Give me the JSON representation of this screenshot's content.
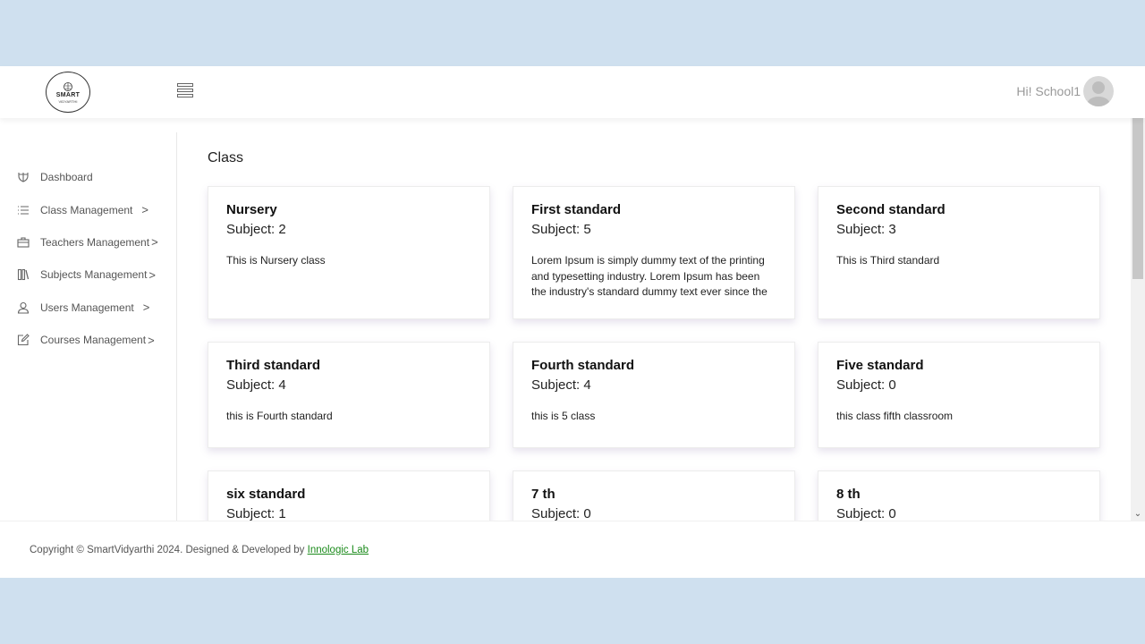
{
  "header": {
    "logo_line1": "SMART",
    "logo_line2": "VIDYARTHI",
    "greeting": "Hi! School1"
  },
  "sidebar": {
    "items": [
      {
        "label": "Dashboard",
        "icon": "dashboard-icon",
        "chevron": ""
      },
      {
        "label": "Class Management",
        "icon": "list-icon",
        "chevron": ">"
      },
      {
        "label": "Teachers Management",
        "icon": "briefcase-icon",
        "chevron": ">"
      },
      {
        "label": "Subjects Management",
        "icon": "books-icon",
        "chevron": ">"
      },
      {
        "label": "Users Management",
        "icon": "user-icon",
        "chevron": ">"
      },
      {
        "label": "Courses Management",
        "icon": "edit-icon",
        "chevron": ">"
      }
    ]
  },
  "main": {
    "title": "Class",
    "cards": [
      {
        "name": "Nursery",
        "subject": "Subject: 2",
        "description": "This is Nursery class"
      },
      {
        "name": "First standard",
        "subject": "Subject: 5",
        "description": "Lorem Ipsum is simply dummy text of the printing and typesetting industry. Lorem Ipsum has been the industry's standard dummy text ever since the"
      },
      {
        "name": "Second standard",
        "subject": "Subject: 3",
        "description": "This is Third standard"
      },
      {
        "name": "Third standard",
        "subject": "Subject: 4",
        "description": "this is Fourth standard"
      },
      {
        "name": "Fourth standard",
        "subject": "Subject: 4",
        "description": "this is 5 class"
      },
      {
        "name": "Five standard",
        "subject": "Subject: 0",
        "description": "this class fifth classroom"
      },
      {
        "name": "six standard",
        "subject": "Subject: 1",
        "description": ""
      },
      {
        "name": "7 th",
        "subject": "Subject: 0",
        "description": ""
      },
      {
        "name": "8 th",
        "subject": "Subject: 0",
        "description": ""
      }
    ]
  },
  "footer": {
    "copyright": "Copyright © SmartVidyarthi 2024. Designed & Developed by ",
    "link_text": "Innologic Lab"
  },
  "colors": {
    "page_background": "#cfe0ef",
    "link": "#1a8a1a"
  }
}
